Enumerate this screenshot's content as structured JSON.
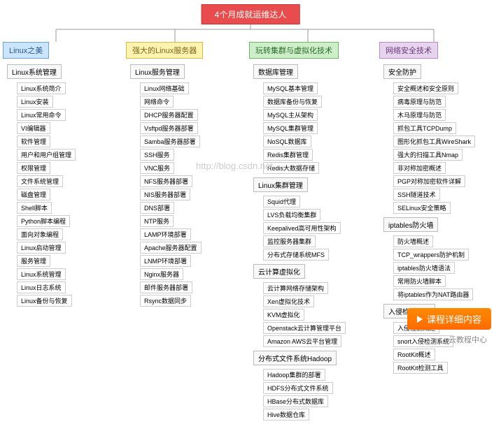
{
  "root_title": "4个月成就运维达人",
  "watermark": "http://blog.csdn.net",
  "cta_label": "课程详细内容",
  "footer": "云教程中心",
  "cols": [
    {
      "cat": "Linux之美",
      "groups": [
        {
          "sub": "Linux系统管理",
          "items": [
            "Linux系统简介",
            "Linux安装",
            "Linux常用命令",
            "VI编辑器",
            "软件管理",
            "用户和用户组管理",
            "权限管理",
            "文件系统管理",
            "磁盘管理",
            "Shell脚本",
            "Python脚本编程",
            "面向对象编程",
            "Linux启动管理",
            "服务管理",
            "Linux系统管理",
            "Linux日志系统",
            "Linux备份与恢复"
          ]
        }
      ]
    },
    {
      "cat": "强大的Linux服务器",
      "groups": [
        {
          "sub": "Linux服务管理",
          "items": [
            "Linux网络基础",
            "网络命令",
            "DHCP服务器配置",
            "Vsftpd服务器部署",
            "Samba服务器部署",
            "SSH服务",
            "VNC服务",
            "NFS服务器部署",
            "NIS服务器部署",
            "DNS部署",
            "NTP服务",
            "LAMP环境部署",
            "Apache服务器配置",
            "LNMP环境部署",
            "Nginx服务器",
            "邮件服务器部署",
            "Rsync数据同步"
          ]
        }
      ]
    },
    {
      "cat": "玩转集群与虚拟化技术",
      "groups": [
        {
          "sub": "数据库管理",
          "items": [
            "MySQL基本管理",
            "数据库备份与恢复",
            "MySQL主从架构",
            "MySQL集群管理",
            "NoSQL数据库",
            "Redis集群管理",
            "Redis大数据存储"
          ]
        },
        {
          "sub": "Linux集群管理",
          "items": [
            "Squid代理",
            "LVS负载均衡集群",
            "Keepalived高可用性架构",
            "监控服务器集群",
            "分布式存储系统MFS"
          ]
        },
        {
          "sub": "云计算虚拟化",
          "items": [
            "云计算网络存储架构",
            "Xen虚拟化技术",
            "KVM虚拟化",
            "Openstack云计算管理平台",
            "Amazon AWS云平台管理"
          ]
        },
        {
          "sub": "分布式文件系统Hadoop",
          "items": [
            "Hadoop集群的部署",
            "HDFS分布式文件系统",
            "HBase分布式数据库",
            "Hive数据仓库"
          ]
        }
      ]
    },
    {
      "cat": "网络安全技术",
      "groups": [
        {
          "sub": "安全防护",
          "items": [
            "安全概述和安全原则",
            "病毒原理与防范",
            "木马原理与防范",
            "抓包工具TCPDump",
            "图形化抓包工具WireShark",
            "强大的扫描工具Nmap",
            "非对称加密概述",
            "PGP对称加密软件详解",
            "SSH隧道技术",
            "SELinux安全策略"
          ]
        },
        {
          "sub": "iptables防火墙",
          "items": [
            "防火墙概述",
            "TCP_wrappers防护机制",
            "iptables防火墙语法",
            "常用防火墙脚本",
            "将iptables作为NAT路由器"
          ]
        },
        {
          "sub": "入侵检测策略",
          "items": [
            "入侵检测概述",
            "snort入侵检测系统",
            "RootKit概述",
            "RootKit检测工具"
          ]
        }
      ]
    }
  ]
}
